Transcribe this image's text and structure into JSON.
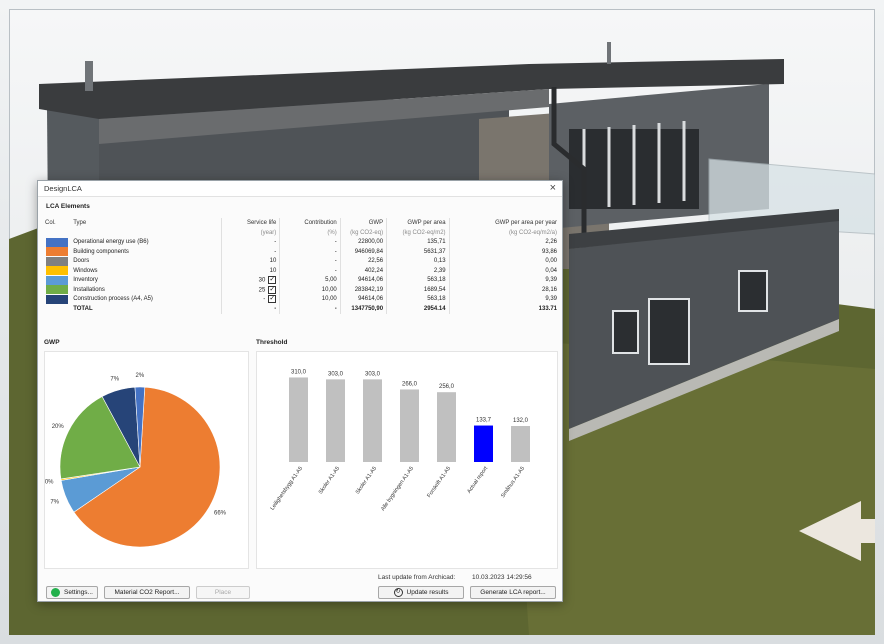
{
  "dialog": {
    "title": "DesignLCA",
    "close_glyph": "×"
  },
  "lca": {
    "section_label": "LCA Elements",
    "columns": {
      "col": "Col.",
      "type": "Type",
      "service_life": "Service life",
      "contribution": "Contribution",
      "gwp": "GWP",
      "gwp_area": "GWP per area",
      "gwp_area_year": "GWP per area per year"
    },
    "units": {
      "service_life": "(year)",
      "contribution": "(%)",
      "gwp": "(kg CO2-eq)",
      "gwp_area": "(kg CO2-eq/m2)",
      "gwp_area_year": "(kg CO2-eq/m2/a)"
    },
    "rows": [
      {
        "color": "#4472c4",
        "type": "Operational energy use (B6)",
        "service_life": "-",
        "checked": false,
        "contribution": "-",
        "gwp": "22800,00",
        "gwp_area": "135,71",
        "gwp_area_year": "2,26"
      },
      {
        "color": "#ed7d31",
        "type": "Building components",
        "service_life": "-",
        "checked": false,
        "contribution": "-",
        "gwp": "946069,84",
        "gwp_area": "5631,37",
        "gwp_area_year": "93,86"
      },
      {
        "color": "#808080",
        "type": "Doors",
        "service_life": "10",
        "checked": false,
        "contribution": "-",
        "gwp": "22,56",
        "gwp_area": "0,13",
        "gwp_area_year": "0,00"
      },
      {
        "color": "#ffc000",
        "type": "Windows",
        "service_life": "10",
        "checked": false,
        "contribution": "-",
        "gwp": "402,24",
        "gwp_area": "2,39",
        "gwp_area_year": "0,04"
      },
      {
        "color": "#5b9bd5",
        "type": "Inventory",
        "service_life": "30",
        "checked": true,
        "contribution": "5,00",
        "gwp": "94614,06",
        "gwp_area": "563,18",
        "gwp_area_year": "9,39"
      },
      {
        "color": "#70ad47",
        "type": "Installations",
        "service_life": "25",
        "checked": true,
        "contribution": "10,00",
        "gwp": "283842,19",
        "gwp_area": "1689,54",
        "gwp_area_year": "28,16"
      },
      {
        "color": "#264478",
        "type": "Construction process (A4, A5)",
        "service_life": "-",
        "checked": true,
        "contribution": "10,00",
        "gwp": "94614,06",
        "gwp_area": "563,18",
        "gwp_area_year": "9,39"
      }
    ],
    "total": {
      "type": "TOTAL",
      "service_life": "-",
      "contribution": "-",
      "gwp": "1347750,90",
      "gwp_area": "2954.14",
      "gwp_area_year": "133.71"
    }
  },
  "gwp_panel": {
    "title": "GWP"
  },
  "threshold_panel": {
    "title": "Threshold"
  },
  "chart_data": [
    {
      "type": "pie",
      "title": "GWP",
      "slices": [
        {
          "label": "66%",
          "value": 66,
          "color": "#ed7d31"
        },
        {
          "label": "7%",
          "value": 7,
          "color": "#5b9bd5"
        },
        {
          "label": "0%",
          "value": 0.3,
          "color": "#ffc000"
        },
        {
          "label": "20%",
          "value": 20,
          "color": "#70ad47"
        },
        {
          "label": "7%",
          "value": 7,
          "color": "#264478"
        },
        {
          "label": "2%",
          "value": 2,
          "color": "#4472c4"
        }
      ]
    },
    {
      "type": "bar",
      "title": "Threshold",
      "categories": [
        "Leilighetsbygg A1-A5",
        "Skoler A1-A5",
        "Skoler A1-A5",
        "Alle bygningen A1-A5",
        "Forskrift A1-A5",
        "Actual report",
        "Småhus A1-A5"
      ],
      "values": [
        310.0,
        303.0,
        303.0,
        266.0,
        256.0,
        133.7,
        132.0
      ],
      "labels": [
        "310,0",
        "303,0",
        "303,0",
        "266,0",
        "256,0",
        "133,7",
        "132,0"
      ],
      "colors": [
        "#c0c0c0",
        "#c0c0c0",
        "#c0c0c0",
        "#c0c0c0",
        "#c0c0c0",
        "#0000ff",
        "#c0c0c0"
      ],
      "ylim": [
        0,
        330
      ]
    }
  ],
  "footer": {
    "settings_label": "Settings...",
    "co2_report_label": "Material CO2 Report...",
    "place_label": "Place",
    "last_update_label": "Last update from Archicad:",
    "last_update_value": "10.03.2023 14:29:56",
    "update_results_label": "Update results",
    "generate_report_label": "Generate LCA report..."
  }
}
